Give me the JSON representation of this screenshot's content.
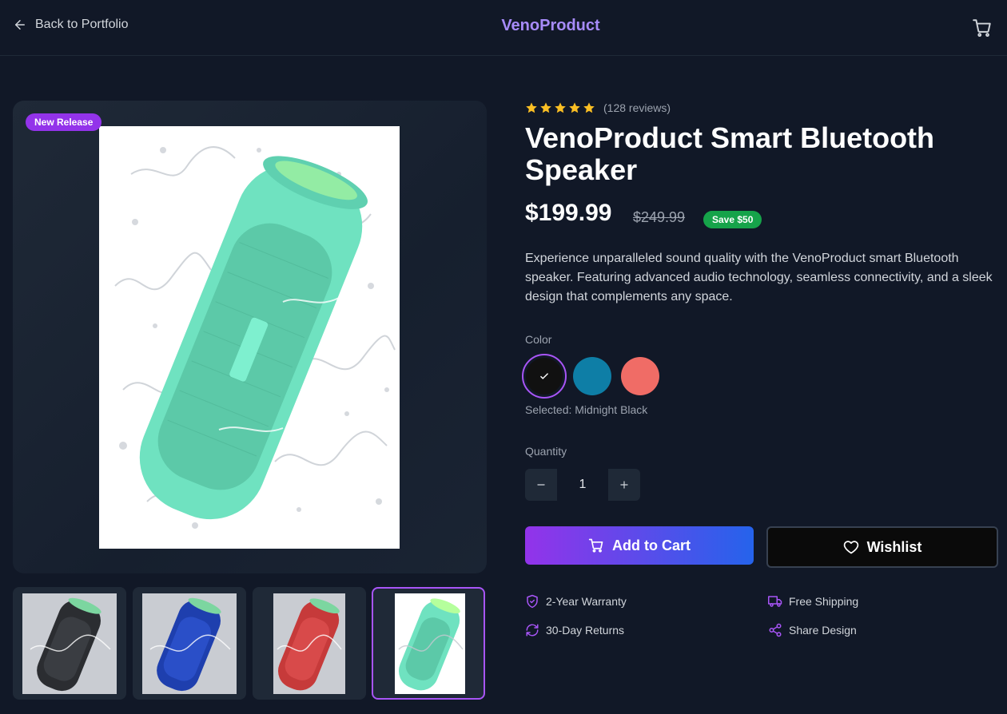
{
  "header": {
    "back_label": "Back to Portfolio",
    "brand": "VenoProduct"
  },
  "gallery": {
    "badge": "New Release",
    "thumbnails": [
      {
        "color": "Midnight Black",
        "body_hex": "#2b2d31"
      },
      {
        "color": "Blue",
        "body_hex": "#1e3fae"
      },
      {
        "color": "Red",
        "body_hex": "#c63a3a"
      },
      {
        "color": "Teal",
        "body_hex": "#6fe2c0"
      }
    ],
    "active_thumbnail": 4
  },
  "product": {
    "rating": 5,
    "reviews": "(128 reviews)",
    "title": "VenoProduct Smart Bluetooth Speaker",
    "price": "$199.99",
    "old_price": "$249.99",
    "save_badge": "Save $50",
    "description": "Experience unparalleled sound quality with the VenoProduct smart Bluetooth speaker. Featuring advanced audio technology, seamless connectivity, and a sleek design that complements any space."
  },
  "color": {
    "label": "Color",
    "swatches": [
      "#111111",
      "#0e7ea6",
      "#f06c66"
    ],
    "selected_text": "Selected: Midnight Black"
  },
  "quantity": {
    "label": "Quantity",
    "value": "1"
  },
  "actions": {
    "add_to_cart": "Add to Cart",
    "wishlist": "Wishlist"
  },
  "features": {
    "warranty": "2-Year Warranty",
    "shipping": "Free Shipping",
    "returns": "30-Day Returns",
    "share": "Share Design"
  },
  "colors": {
    "accent": "#a855f7",
    "star": "#fbbf24",
    "save_green": "#16a34a"
  }
}
